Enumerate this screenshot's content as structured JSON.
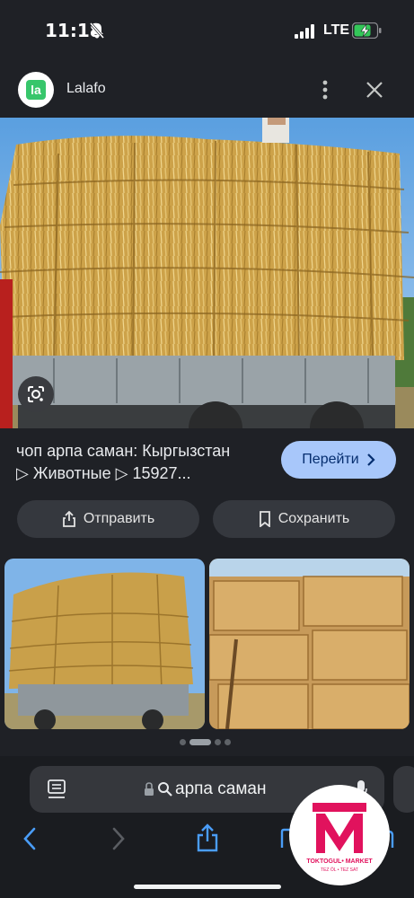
{
  "status_bar": {
    "time": "11:18",
    "network": "LTE"
  },
  "header": {
    "site_name": "Lalafo",
    "logo_letters": "la"
  },
  "result": {
    "title_line1": "чоп арпа саман: Кыргызстан",
    "title_line2": "▷ Животные ▷ 15927...",
    "visit_label": "Перейти"
  },
  "actions": {
    "share_label": "Отправить",
    "save_label": "Сохранить"
  },
  "address_bar": {
    "query": "арпа саман"
  },
  "badge": {
    "brand": "TOKTOGUL• MARKET",
    "phones": "TEZ ÖL • TEZ SAT"
  },
  "colors": {
    "accent": "#a8c7fa",
    "background": "#1f2126",
    "badge_pink": "#e1125d",
    "lalafo_green": "#37c66b"
  },
  "icons": [
    "bell-slash-icon",
    "signal-icon",
    "battery-charging-icon",
    "more-vert-icon",
    "close-icon",
    "google-lens-icon",
    "chevron-right-icon",
    "share-icon",
    "bookmark-icon",
    "reader-icon",
    "lock-icon",
    "search-icon",
    "mic-icon",
    "back-icon",
    "forward-icon",
    "share-icon",
    "bookmarks-icon",
    "tabs-icon"
  ]
}
